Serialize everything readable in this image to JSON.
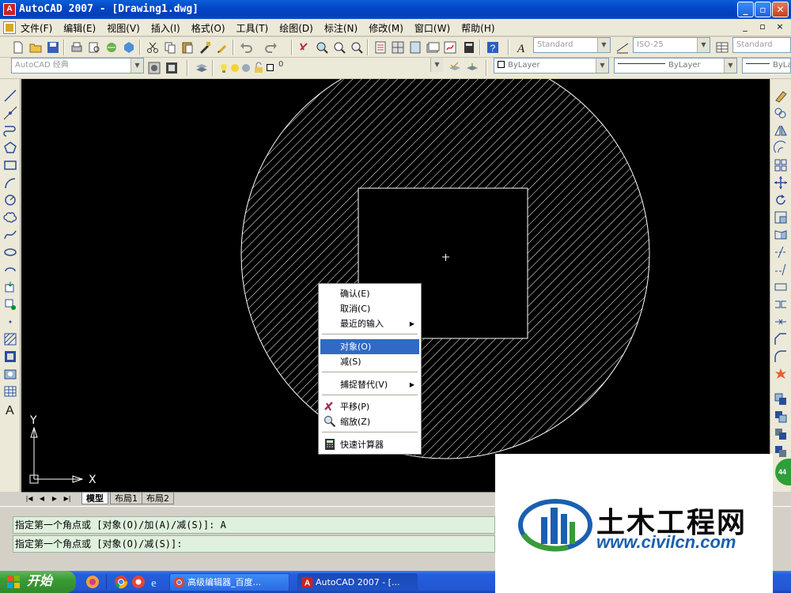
{
  "window": {
    "title": "AutoCAD 2007 - [Drawing1.dwg]",
    "controls": [
      "_",
      "▫",
      "✕"
    ]
  },
  "menubar": {
    "items": [
      "文件(F)",
      "编辑(E)",
      "视图(V)",
      "插入(I)",
      "格式(O)",
      "工具(T)",
      "绘图(D)",
      "标注(N)",
      "修改(M)",
      "窗口(W)",
      "帮助(H)"
    ],
    "mdi_controls": [
      "_",
      "▫",
      "×"
    ]
  },
  "toolbar1": {
    "text_style": "Standard",
    "dim_style": "ISO-25",
    "table_style": "Standard"
  },
  "toolbar2": {
    "workspace": "AutoCAD 经典",
    "layer": "0",
    "color": "ByLayer",
    "linetype": "ByLayer",
    "lineweight": "ByLa"
  },
  "ucs": {
    "y_label": "Y",
    "x_label": "X"
  },
  "context_menu": {
    "items": [
      {
        "label": "确认(E)",
        "highlighted": false,
        "submenu": false,
        "icon": ""
      },
      {
        "label": "取消(C)",
        "highlighted": false,
        "submenu": false,
        "icon": ""
      },
      {
        "label": "最近的输入",
        "highlighted": false,
        "submenu": true,
        "icon": ""
      },
      {
        "label": "对象(O)",
        "highlighted": true,
        "submenu": false,
        "icon": ""
      },
      {
        "label": "减(S)",
        "highlighted": false,
        "submenu": false,
        "icon": ""
      },
      {
        "label": "捕捉替代(V)",
        "highlighted": false,
        "submenu": true,
        "icon": ""
      },
      {
        "label": "平移(P)",
        "highlighted": false,
        "submenu": false,
        "icon": "pan-icon"
      },
      {
        "label": "缩放(Z)",
        "highlighted": false,
        "submenu": false,
        "icon": "zoom-icon"
      },
      {
        "label": "快速计算器",
        "highlighted": false,
        "submenu": false,
        "icon": "calculator-icon"
      }
    ]
  },
  "layout_tabs": {
    "nav": [
      "|◀",
      "◀",
      "▶",
      "▶|"
    ],
    "tabs": [
      "模型",
      "布局1",
      "布局2"
    ],
    "active": "模型"
  },
  "command": {
    "history": "指定第一个角点或 [对象(O)/加(A)/减(S)]: A",
    "prompt": "指定第一个角点或 [对象(O)/减(S)]:"
  },
  "taskbar": {
    "start_label": "开始",
    "tasks": [
      "高级编辑器_百度...",
      "AutoCAD 2007 - [..."
    ]
  },
  "watermark": {
    "text": "土木工程网",
    "url": "www.civilcn.com"
  },
  "badge_text": "44",
  "colors": {
    "canvas": "#000000",
    "hatch": "#ffffff",
    "highlight": "#316ac5",
    "titlebar": "#0a5fd8",
    "cmd_bg": "#dff1de"
  }
}
